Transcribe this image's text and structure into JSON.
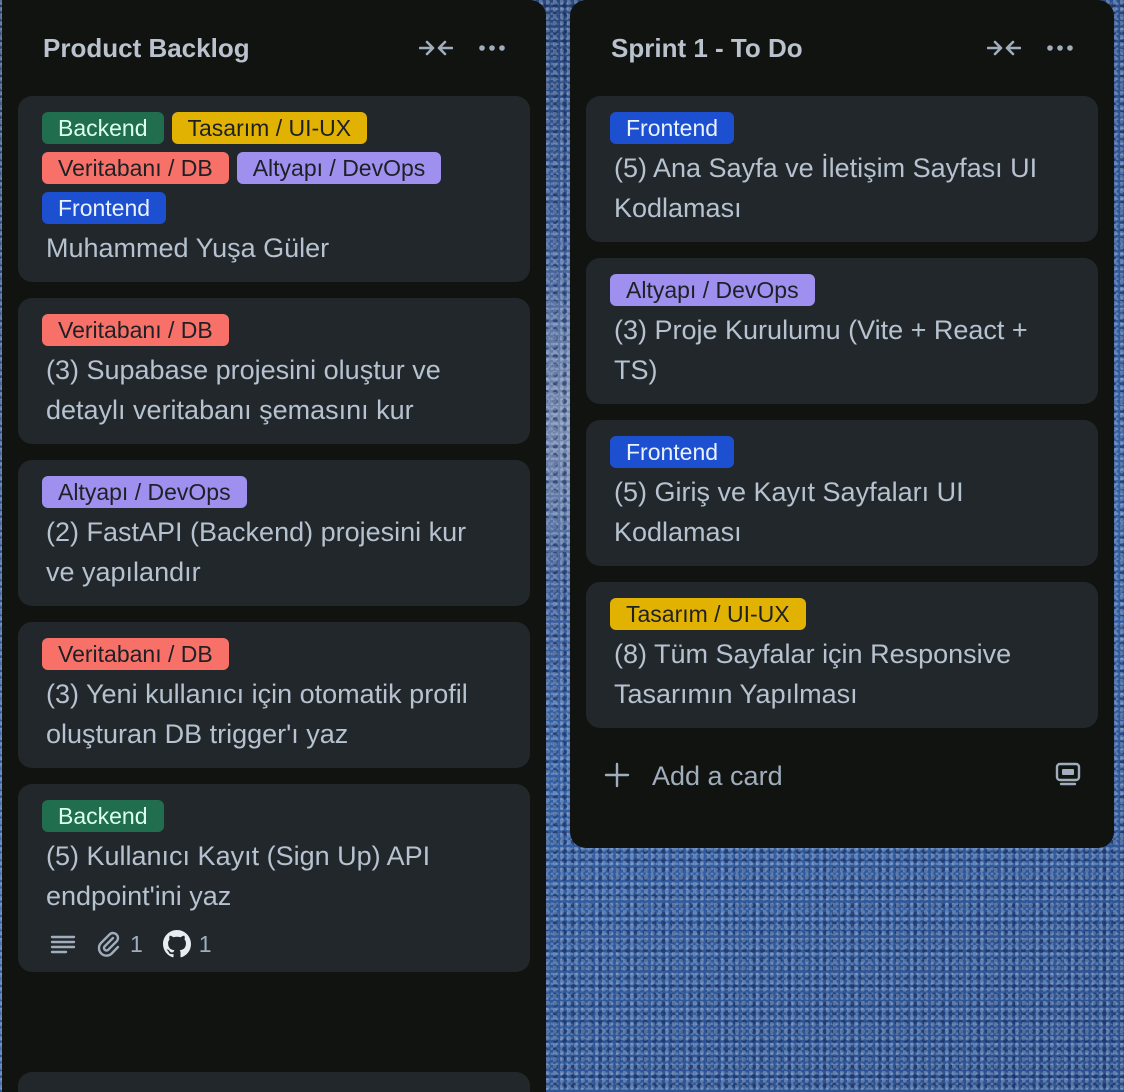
{
  "colors": {
    "list_bg": "#111310",
    "card_bg": "#22272b",
    "text": "#b6c2cf",
    "label_backend": "#216e4e",
    "label_design": "#e2b203",
    "label_db": "#f87168",
    "label_devops": "#9f8fef",
    "label_frontend": "#1d4fd1"
  },
  "lists": [
    {
      "title": "Product Backlog",
      "cards": [
        {
          "labels": [
            "Backend",
            "Tasarım / UI-UX",
            "Veritabanı / DB",
            "Altyapı / DevOps",
            "Frontend"
          ],
          "title": "Muhammed Yuşa Güler"
        },
        {
          "labels": [
            "Veritabanı / DB"
          ],
          "title": "(3) Supabase projesini oluştur ve detaylı veritabanı şemasını kur"
        },
        {
          "labels": [
            "Altyapı / DevOps"
          ],
          "title": "(2) FastAPI (Backend) projesini kur ve yapılandır"
        },
        {
          "labels": [
            "Veritabanı / DB"
          ],
          "title": "(3) Yeni kullanıcı için otomatik profil oluşturan DB trigger'ı yaz"
        },
        {
          "labels": [
            "Backend"
          ],
          "title": "(5) Kullanıcı Kayıt (Sign Up) API endpoint'ini yaz",
          "badges": {
            "description_icon": "description-icon",
            "attachments": "1",
            "github": "1"
          }
        }
      ]
    },
    {
      "title": "Sprint 1 - To Do",
      "cards": [
        {
          "labels": [
            "Frontend"
          ],
          "title": "(5) Ana Sayfa ve İletişim Sayfası UI Kodlaması"
        },
        {
          "labels": [
            "Altyapı / DevOps"
          ],
          "title": "(3) Proje Kurulumu (Vite + React + TS)"
        },
        {
          "labels": [
            "Frontend"
          ],
          "title": "(5) Giriş ve Kayıt Sayfaları UI Kodlaması"
        },
        {
          "labels": [
            "Tasarım / UI-UX"
          ],
          "title": "(8) Tüm Sayfalar için Responsive Tasarımın Yapılması"
        }
      ],
      "add_card_label": "Add a card"
    }
  ],
  "icons": {
    "collapse": "collapse-icon",
    "more": "more-icon",
    "add": "plus-icon",
    "template": "template-icon",
    "description": "description-icon",
    "attachment": "paperclip-icon",
    "github": "github-icon"
  }
}
